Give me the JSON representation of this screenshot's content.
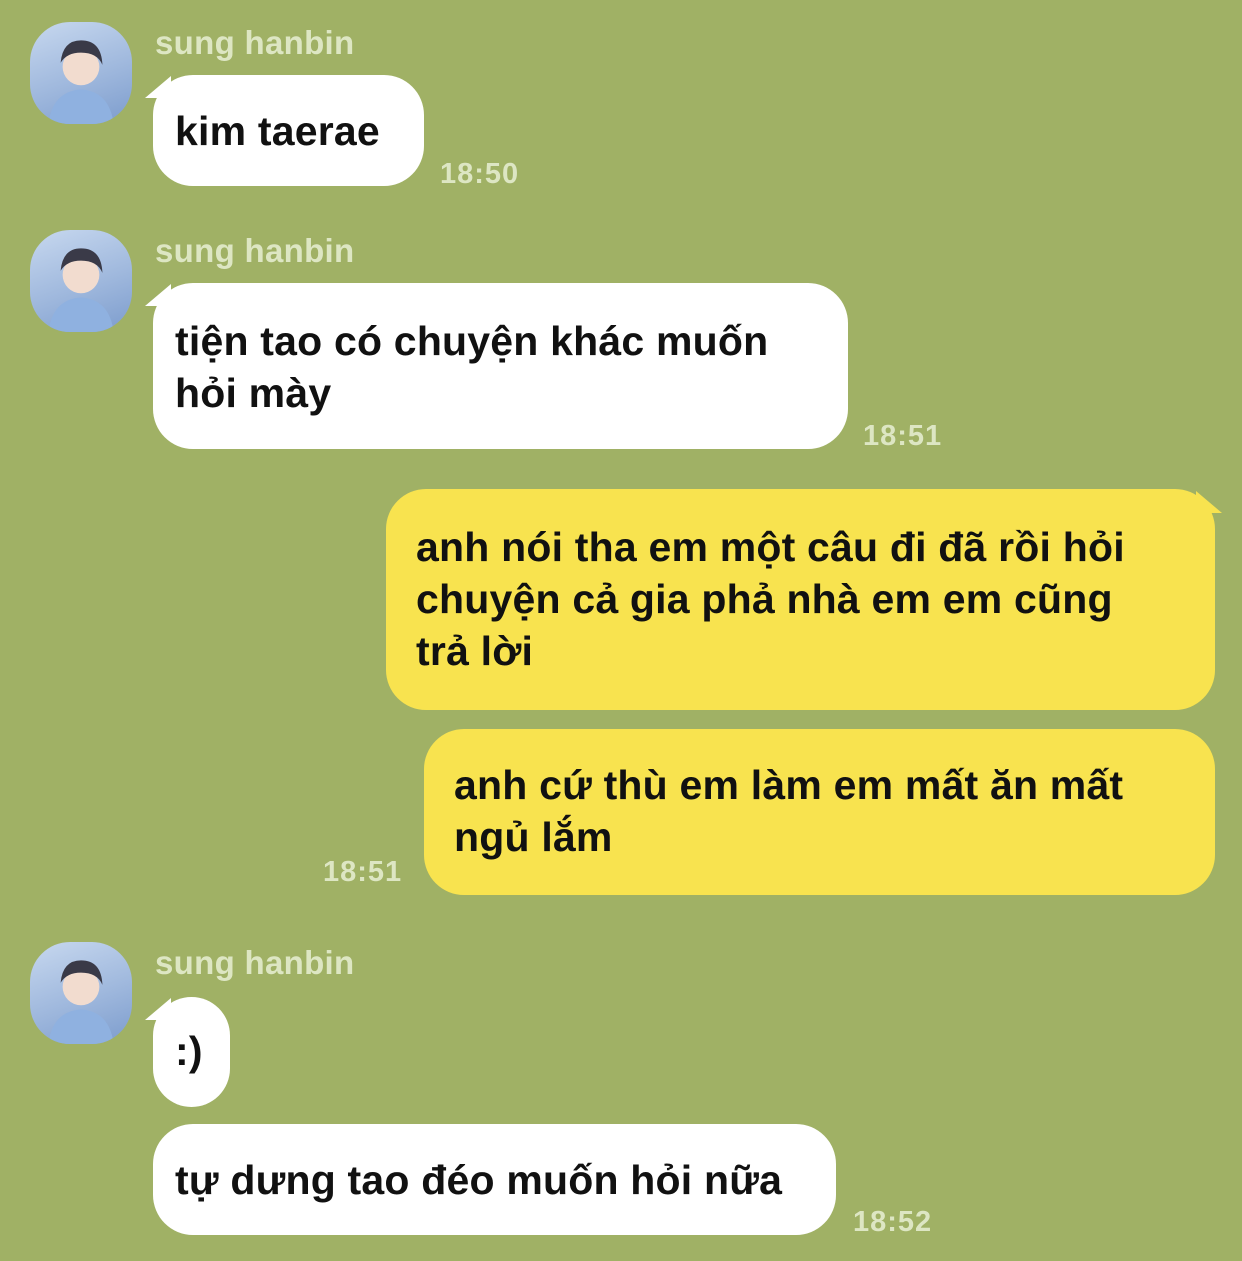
{
  "chat": {
    "sender_name": "sung hanbin",
    "colors": {
      "background": "#a0b165",
      "incoming_bubble": "#ffffff",
      "outgoing_bubble": "#f8e34f",
      "meta_text": "#dde6c3"
    },
    "messages": [
      {
        "direction": "in",
        "text": "kim taerae",
        "time": "18:50"
      },
      {
        "direction": "in",
        "text": "tiện tao có chuyện khác muốn\nhỏi mày",
        "time": "18:51"
      },
      {
        "direction": "out",
        "text": "anh nói tha em một câu đi đã rồi hỏi\nchuyện cả gia phả nhà em em cũng\ntrả lời"
      },
      {
        "direction": "out",
        "text": "anh cứ thù em làm em mất ăn mất\nngủ lắm",
        "time": "18:51"
      },
      {
        "direction": "in",
        "text": ":)"
      },
      {
        "direction": "in",
        "text": "tự dưng tao đéo muốn hỏi nữa",
        "time": "18:52"
      }
    ]
  }
}
